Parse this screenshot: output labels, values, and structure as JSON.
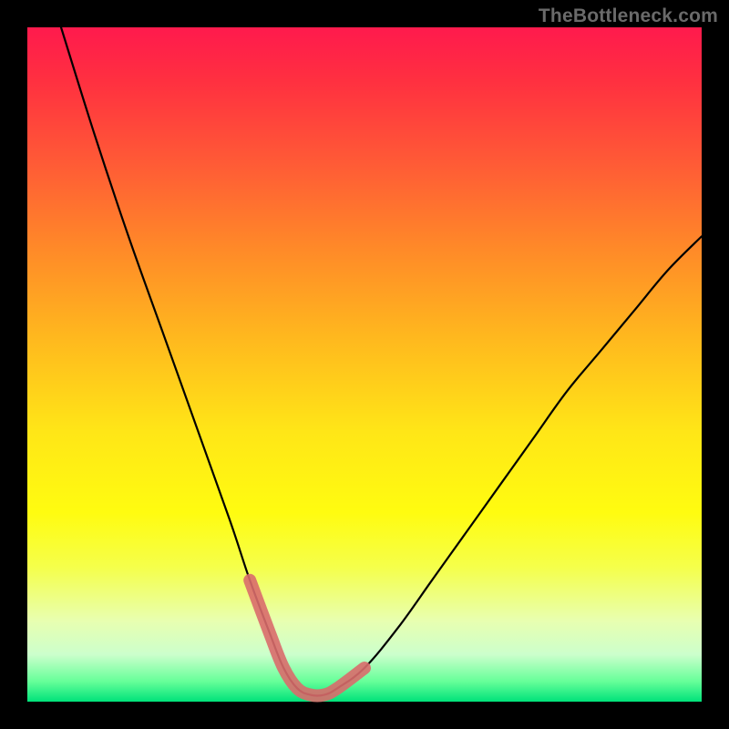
{
  "watermark": "TheBottleneck.com",
  "chart_data": {
    "type": "line",
    "title": "",
    "xlabel": "",
    "ylabel": "",
    "xlim": [
      0,
      100
    ],
    "ylim": [
      0,
      100
    ],
    "series": [
      {
        "name": "bottleneck-curve",
        "x": [
          5,
          10,
          15,
          20,
          25,
          30,
          33,
          36,
          38,
          40,
          42,
          44,
          46,
          50,
          55,
          60,
          65,
          70,
          75,
          80,
          85,
          90,
          95,
          100
        ],
        "values": [
          100,
          84,
          69,
          55,
          41,
          27,
          18,
          10,
          5,
          2,
          1,
          1,
          2,
          5,
          11,
          18,
          25,
          32,
          39,
          46,
          52,
          58,
          64,
          69
        ]
      }
    ],
    "highlight": {
      "name": "optimal-zone",
      "x": [
        33,
        36,
        38,
        40,
        42,
        44,
        46,
        50
      ],
      "values": [
        18,
        10,
        5,
        2,
        1,
        1,
        2,
        5
      ],
      "color": "#d96b6b"
    },
    "gradient_stops": [
      {
        "pos": 0,
        "color": "#ff1a4d"
      },
      {
        "pos": 50,
        "color": "#ffe617"
      },
      {
        "pos": 100,
        "color": "#00e27a"
      }
    ]
  }
}
